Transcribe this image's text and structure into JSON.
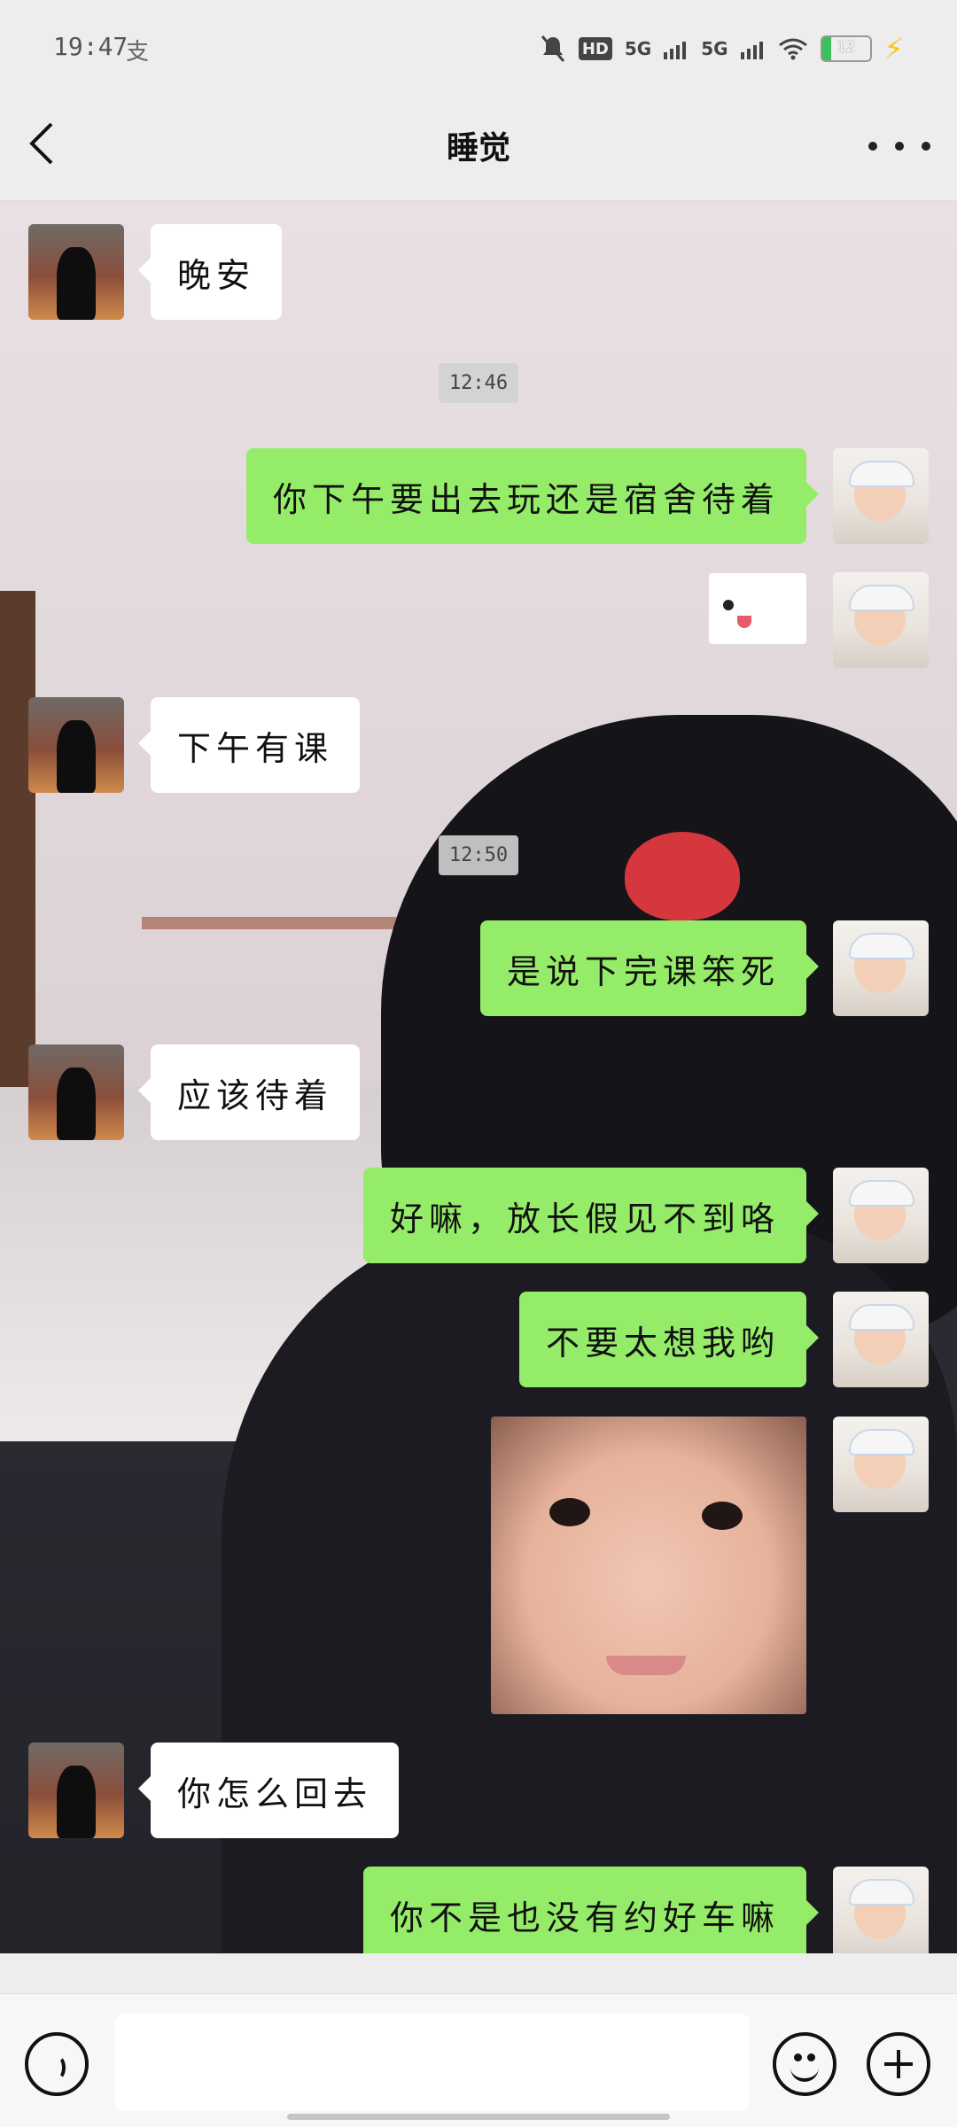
{
  "status_bar": {
    "time": "19:47",
    "extra": "支",
    "network_1": "5G",
    "network_2": "5G",
    "hd_label": "HD",
    "battery_level": "12"
  },
  "header": {
    "title": "睡觉",
    "back_icon": "chevron-left-icon",
    "more_icon": "more-dots-icon"
  },
  "messages": [
    {
      "side": "left",
      "text": "晚安"
    },
    {
      "type": "timestamp",
      "text": "12:46"
    },
    {
      "side": "right",
      "text": "你下午要出去玩还是宿舍待着"
    },
    {
      "side": "right",
      "type": "sticker",
      "text": ""
    },
    {
      "side": "left",
      "text": "下午有课"
    },
    {
      "type": "timestamp",
      "text": "12:50"
    },
    {
      "side": "right",
      "text": "是说下完课笨死"
    },
    {
      "side": "left",
      "text": "应该待着"
    },
    {
      "side": "right",
      "text": "好嘛，放长假见不到咯"
    },
    {
      "side": "right",
      "text": "不要太想我哟"
    },
    {
      "side": "right",
      "type": "sticker",
      "text": ""
    },
    {
      "side": "left",
      "text": "你怎么回去"
    },
    {
      "side": "right",
      "text": "你不是也没有约好车嘛"
    }
  ],
  "input_bar": {
    "voice_icon": "voice-icon",
    "emoji_icon": "emoji-icon",
    "plus_icon": "plus-icon",
    "input_value": ""
  },
  "colors": {
    "sent_bubble": "#95ec69",
    "received_bubble": "#ffffff",
    "bar_background": "#ededed"
  }
}
